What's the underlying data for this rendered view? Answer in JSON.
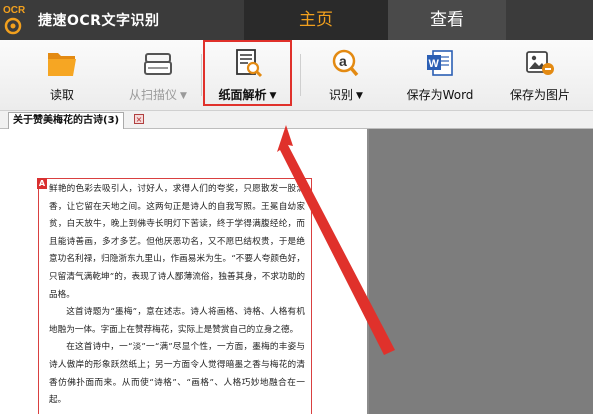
{
  "app": {
    "logo_text": "OCR",
    "title": "捷速OCR文字识别"
  },
  "tabs": [
    {
      "label": "主页",
      "active": true
    },
    {
      "label": "查看",
      "active": false
    }
  ],
  "toolbar": {
    "read": "读取",
    "scan": "从扫描仪",
    "layout": "纸面解析",
    "recognize": "识别",
    "save_word": "保存为Word",
    "save_image": "保存为图片",
    "caret": "▼"
  },
  "document_tab": {
    "title": "关于赞美梅花的古诗(3)",
    "close": "×"
  },
  "page": {
    "marker": "A",
    "paragraphs": [
      "鲜艳的色彩去吸引人，讨好人，求得人们的夸奖，只愿散发一股清香，让它留在天地之间。这两句正是诗人的自我写照。王冕自幼家贫，白天放牛，晚上到佛寺长明灯下苦读，终于学得满腹经纶，而且能诗善画，多才多艺。但他厌恶功名，又不愿巴结权贵，于是绝意功名利禄，归隐浙东九里山，作画易米为生。“不要人夸颜色好，只留清气满乾坤”的，表现了诗人鄙薄流俗，独善其身，不求功助的品格。",
      "这首诗题为“墨梅”，意在述志。诗人将画格、诗格、人格有机地融为一体。字面上在赞荐梅花，实际上是赞赏自己的立身之德。",
      "在这首诗中，一“淡”一“满”尽显个性，一方面，墨梅的丰姿与诗人傲岸的形象跃然纸上；另一方面令人觉得暗墨之香与梅花的清香仿佛扑面而来。从而使“诗格”、“画格”、人格巧妙地融合在一起。"
    ]
  },
  "colors": {
    "titlebar": "#3b3b3b",
    "active_tab_text": "#f2a01e",
    "highlight": "#e0312b",
    "arrow": "#e0312b"
  }
}
